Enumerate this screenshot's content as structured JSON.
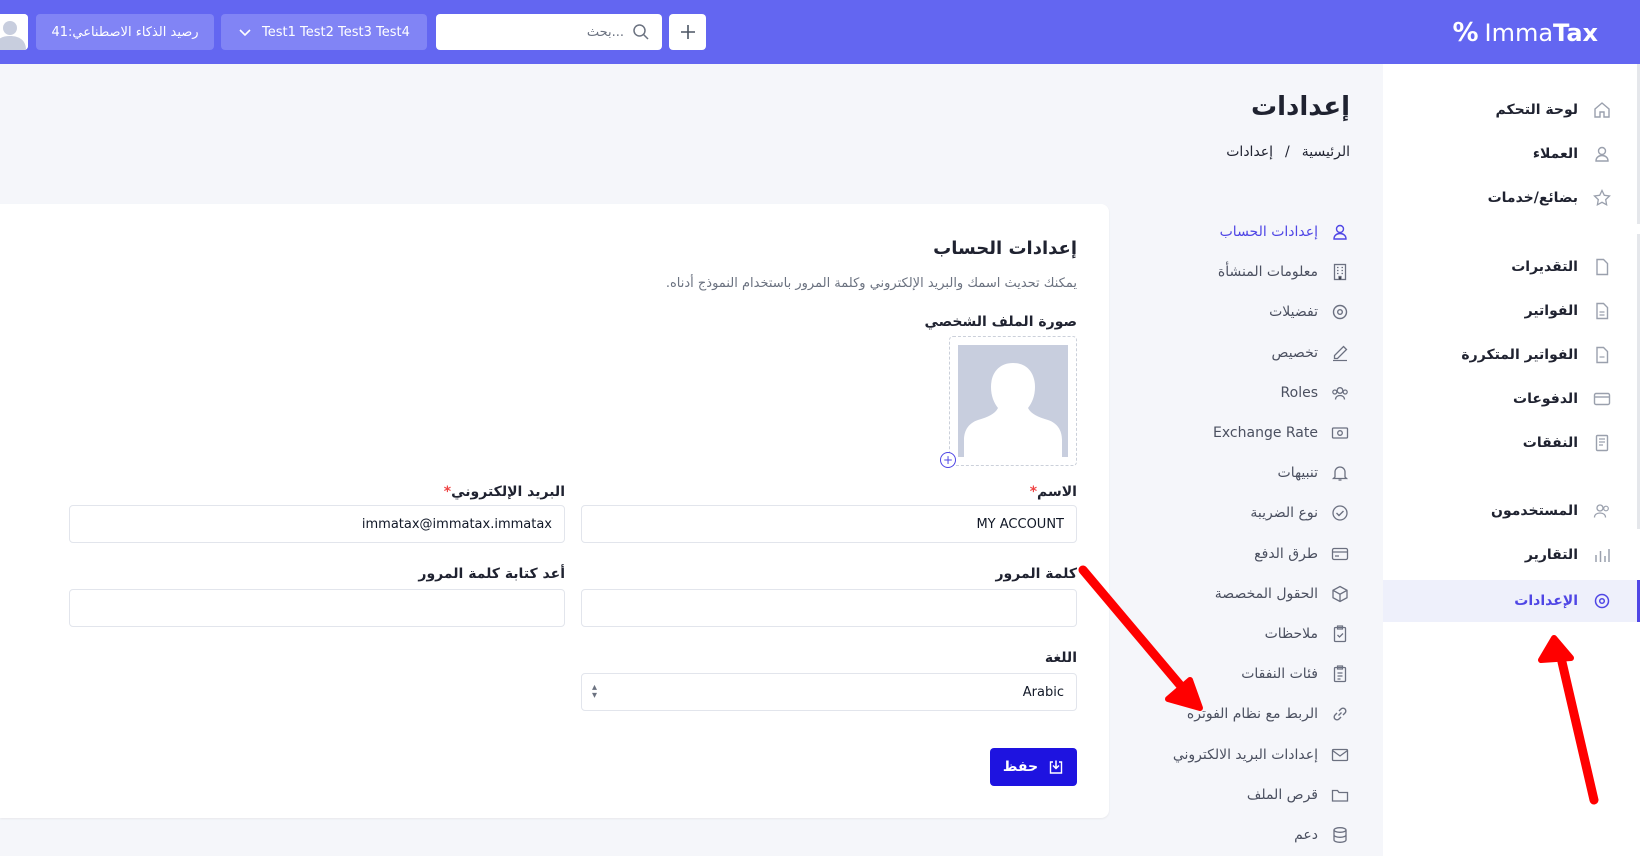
{
  "colors": {
    "accent": "#6366f1",
    "primary_button": "#1e13e0",
    "active": "#4f46e5",
    "annotation_arrow": "#ff0000"
  },
  "topbar": {
    "logo_text_1": "Imma",
    "logo_text_2": "Tax",
    "add_icon": "plus-icon",
    "search_placeholder": "بحث...",
    "company_selector": "Test1 Test2 Test3 Test4",
    "ai_balance": "رصيد الذكاء الاصطناعي:41"
  },
  "sidebar": {
    "items": [
      {
        "label": "لوحة التحكم",
        "icon": "home-icon"
      },
      {
        "label": "العملاء",
        "icon": "user-icon"
      },
      {
        "label": "بضائع/خدمات",
        "icon": "star-icon"
      },
      {
        "label": "التقديرات",
        "icon": "document-icon"
      },
      {
        "label": "الفواتير",
        "icon": "invoice-icon"
      },
      {
        "label": "الفواتير المتكررة",
        "icon": "recurring-invoice-icon"
      },
      {
        "label": "الدفوعات",
        "icon": "credit-card-icon"
      },
      {
        "label": "النفقات",
        "icon": "receipt-icon"
      },
      {
        "label": "المستخدمون",
        "icon": "users-icon"
      },
      {
        "label": "التقارير",
        "icon": "chart-icon"
      },
      {
        "label": "الإعدادات",
        "icon": "settings-icon",
        "active": true
      }
    ]
  },
  "page": {
    "title": "إعدادات",
    "breadcrumb_home": "الرئيسية",
    "breadcrumb_sep": "/",
    "breadcrumb_current": "إعدادات"
  },
  "settings_nav": [
    {
      "label": "إعدادات الحساب",
      "icon": "user-icon",
      "active": true
    },
    {
      "label": "معلومات المنشأة",
      "icon": "building-icon"
    },
    {
      "label": "تفضيلات",
      "icon": "settings-icon"
    },
    {
      "label": "تخصيص",
      "icon": "edit-icon"
    },
    {
      "label": "Roles",
      "icon": "users-icon"
    },
    {
      "label": "Exchange Rate",
      "icon": "cash-icon"
    },
    {
      "label": "تنبيهات",
      "icon": "bell-icon"
    },
    {
      "label": "نوع الضريبة",
      "icon": "check-circle-icon"
    },
    {
      "label": "طرق الدفع",
      "icon": "credit-card-icon"
    },
    {
      "label": "الحقول المخصصة",
      "icon": "cube-icon"
    },
    {
      "label": "ملاحظات",
      "icon": "clipboard-check-icon"
    },
    {
      "label": "فئات النفقات",
      "icon": "clipboard-list-icon"
    },
    {
      "label": "الربط مع نظام الفوتره",
      "icon": "link-icon"
    },
    {
      "label": "إعدادات البريد الالكتروني",
      "icon": "mail-icon"
    },
    {
      "label": "قرص الملف",
      "icon": "folder-icon"
    },
    {
      "label": "دعم",
      "icon": "database-icon"
    }
  ],
  "account": {
    "title": "إعدادات الحساب",
    "description": "يمكنك تحديث اسمك والبريد الإلكتروني وكلمة المرور باستخدام النموذج أدناه.",
    "photo_label": "صورة الملف الشخصي",
    "name_label": "الاسم",
    "name_value": "MY ACCOUNT",
    "email_label": "البريد الإلكتروني",
    "email_value": "immatax@immatax.immatax",
    "password_label": "كلمة المرور",
    "password_value": "",
    "confirm_password_label": "أعد كتابة كلمة المرور",
    "confirm_password_value": "",
    "language_label": "اللغة",
    "language_value": "Arabic",
    "required_mark": "*",
    "save_label": "حفظ"
  }
}
